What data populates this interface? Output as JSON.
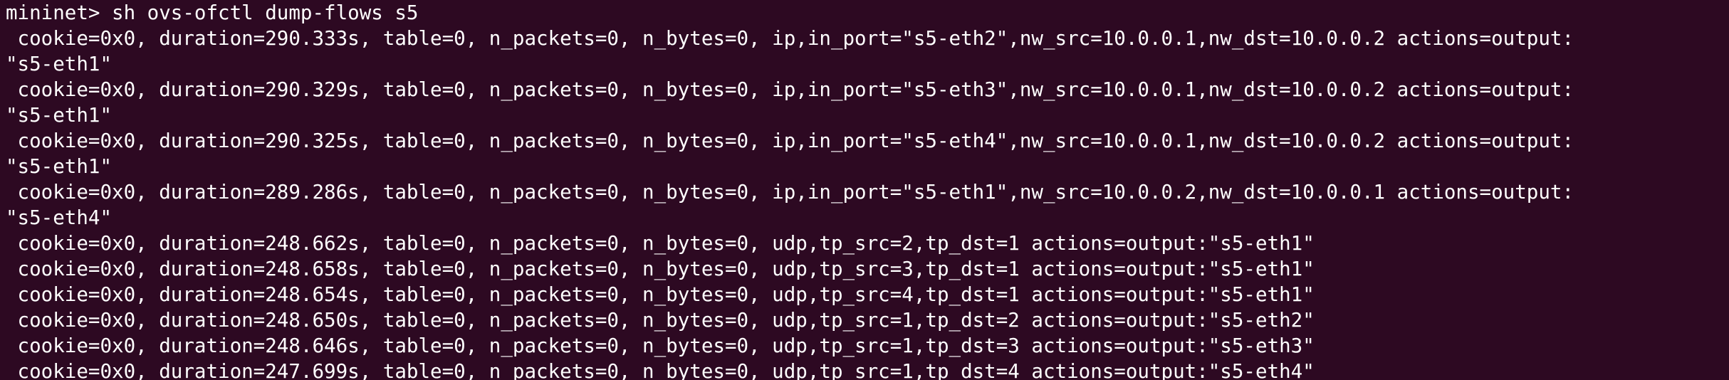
{
  "terminal": {
    "lines": [
      "mininet> sh ovs-ofctl dump-flows s5",
      " cookie=0x0, duration=290.333s, table=0, n_packets=0, n_bytes=0, ip,in_port=\"s5-eth2\",nw_src=10.0.0.1,nw_dst=10.0.0.2 actions=output:",
      "\"s5-eth1\"",
      " cookie=0x0, duration=290.329s, table=0, n_packets=0, n_bytes=0, ip,in_port=\"s5-eth3\",nw_src=10.0.0.1,nw_dst=10.0.0.2 actions=output:",
      "\"s5-eth1\"",
      " cookie=0x0, duration=290.325s, table=0, n_packets=0, n_bytes=0, ip,in_port=\"s5-eth4\",nw_src=10.0.0.1,nw_dst=10.0.0.2 actions=output:",
      "\"s5-eth1\"",
      " cookie=0x0, duration=289.286s, table=0, n_packets=0, n_bytes=0, ip,in_port=\"s5-eth1\",nw_src=10.0.0.2,nw_dst=10.0.0.1 actions=output:",
      "\"s5-eth4\"",
      " cookie=0x0, duration=248.662s, table=0, n_packets=0, n_bytes=0, udp,tp_src=2,tp_dst=1 actions=output:\"s5-eth1\"",
      " cookie=0x0, duration=248.658s, table=0, n_packets=0, n_bytes=0, udp,tp_src=3,tp_dst=1 actions=output:\"s5-eth1\"",
      " cookie=0x0, duration=248.654s, table=0, n_packets=0, n_bytes=0, udp,tp_src=4,tp_dst=1 actions=output:\"s5-eth1\"",
      " cookie=0x0, duration=248.650s, table=0, n_packets=0, n_bytes=0, udp,tp_src=1,tp_dst=2 actions=output:\"s5-eth2\"",
      " cookie=0x0, duration=248.646s, table=0, n_packets=0, n_bytes=0, udp,tp_src=1,tp_dst=3 actions=output:\"s5-eth3\"",
      " cookie=0x0, duration=247.699s, table=0, n_packets=0, n_bytes=0, udp,tp_src=1,tp_dst=4 actions=output:\"s5-eth4\""
    ]
  },
  "colors": {
    "background": "#2d0922",
    "foreground": "#ffffff"
  }
}
